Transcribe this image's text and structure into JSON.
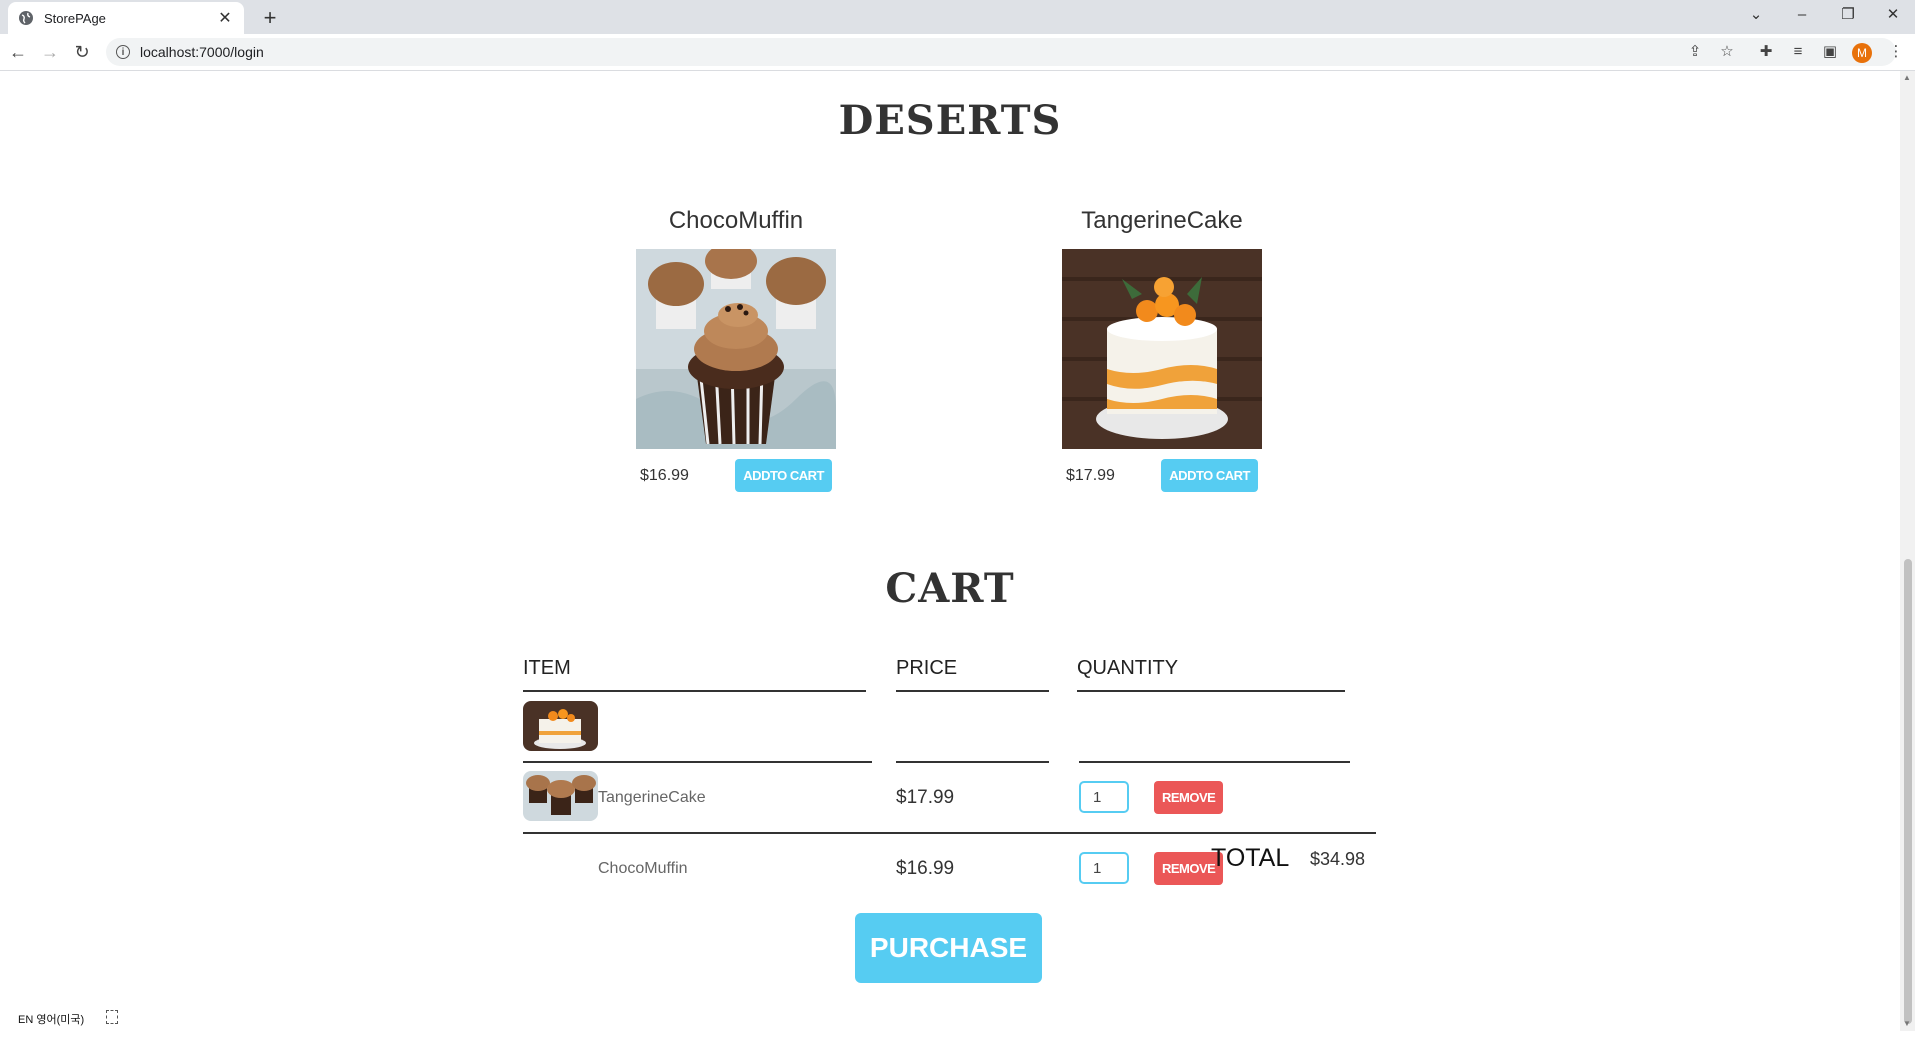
{
  "browser": {
    "tab_title": "StorePAge",
    "url": "localhost:7000/login",
    "avatar_letter": "M",
    "ime_indicator": "EN 영어(미국)"
  },
  "store": {
    "section_title": "DESERTS",
    "items": [
      {
        "title": "ChocoMuffin",
        "price": "$16.99",
        "button": "ADDTO CART"
      },
      {
        "title": "TangerineCake",
        "price": "$17.99",
        "button": "ADDTO CART"
      }
    ]
  },
  "cart": {
    "section_title": "CART",
    "headers": {
      "item": "ITEM",
      "price": "PRICE",
      "quantity": "QUANTITY"
    },
    "rows": [
      {
        "title": "TangerineCake",
        "price": "$17.99",
        "quantity": "1",
        "remove_label": "REMOVE"
      },
      {
        "title": "ChocoMuffin",
        "price": "$16.99",
        "quantity": "1",
        "remove_label": "REMOVE"
      }
    ],
    "total_label": "TOTAL",
    "total_price": "$34.98",
    "purchase_label": "PURCHASE"
  },
  "colors": {
    "primary": "#56ccf2",
    "danger": "#eb5757"
  }
}
